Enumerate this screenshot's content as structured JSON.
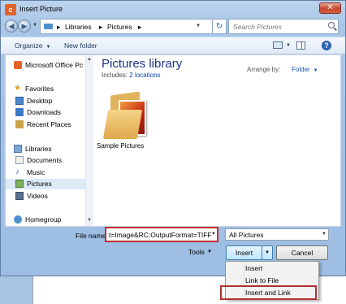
{
  "window": {
    "title": "Insert Picture",
    "close_glyph": "✕"
  },
  "nav": {
    "back_glyph": "◀",
    "forward_glyph": "▶",
    "breadcrumb": [
      "Libraries",
      "Pictures"
    ],
    "separator": "▸",
    "search_placeholder": "Search Pictures",
    "refresh_glyph": "↻"
  },
  "toolbar": {
    "organize": "Organize",
    "new_folder": "New folder",
    "help": "?"
  },
  "sidebar": {
    "items": [
      {
        "label": "Microsoft Office Pc",
        "icon": "office-icon"
      },
      {
        "label": "Favorites",
        "icon": "star-icon"
      },
      {
        "label": "Desktop",
        "icon": "desktop-icon"
      },
      {
        "label": "Downloads",
        "icon": "downloads-icon"
      },
      {
        "label": "Recent Places",
        "icon": "recent-places-icon"
      },
      {
        "label": "Libraries",
        "icon": "libraries-icon"
      },
      {
        "label": "Documents",
        "icon": "documents-icon"
      },
      {
        "label": "Music",
        "icon": "music-icon"
      },
      {
        "label": "Pictures",
        "icon": "pictures-icon",
        "selected": true
      },
      {
        "label": "Videos",
        "icon": "videos-icon"
      },
      {
        "label": "Homegroup",
        "icon": "homegroup-icon"
      }
    ]
  },
  "library": {
    "title": "Pictures library",
    "includes_label": "Includes:",
    "includes_link": "2 locations",
    "arrange_label": "Arrange by:",
    "arrange_value": "Folder"
  },
  "items": [
    {
      "name": "Sample Pictures",
      "icon": "picture-folder-icon"
    }
  ],
  "filename": {
    "label": "File name:",
    "value": "t=Image&RC:OutputFormat=TIFF"
  },
  "filter": {
    "value": "All Pictures"
  },
  "buttons": {
    "tools": "Tools",
    "insert": "Insert",
    "cancel": "Cancel"
  },
  "insert_menu": {
    "items": [
      "Insert",
      "Link to File",
      "Insert and Link"
    ],
    "highlighted": "Insert and Link"
  },
  "colors": {
    "highlight_border": "#c13030",
    "library_title": "#1e3287",
    "link": "#0645ad"
  }
}
